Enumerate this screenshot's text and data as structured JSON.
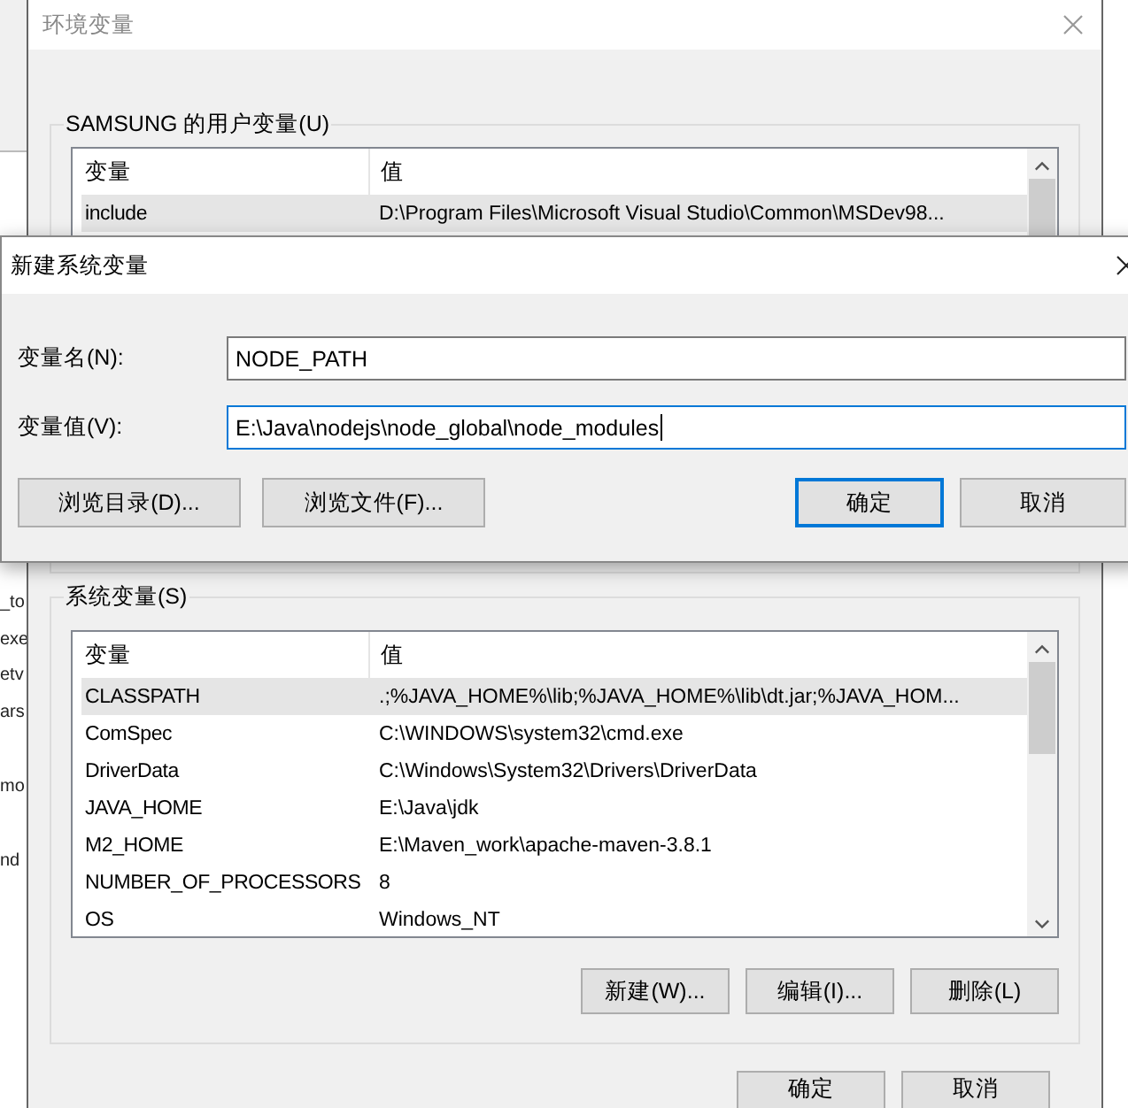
{
  "side_fragments": [
    {
      "lines": [
        "_to",
        "exe",
        "etv",
        "ars"
      ]
    },
    {
      "lines": [
        "mo"
      ]
    },
    {
      "lines": [
        "nd"
      ]
    }
  ],
  "background_window": {
    "title": "环境变量",
    "user_variables": {
      "title": "SAMSUNG 的用户变量(U)",
      "columns": [
        "变量",
        "值"
      ],
      "rows": [
        {
          "name": "include",
          "value": "D:\\Program Files\\Microsoft Visual Studio\\Common\\MSDev98...",
          "selected": true
        }
      ]
    },
    "system_variables": {
      "title": "系统变量(S)",
      "columns": [
        "变量",
        "值"
      ],
      "rows": [
        {
          "name": "CLASSPATH",
          "value": ".;%JAVA_HOME%\\lib;%JAVA_HOME%\\lib\\dt.jar;%JAVA_HOM...",
          "selected": true
        },
        {
          "name": "ComSpec",
          "value": "C:\\WINDOWS\\system32\\cmd.exe",
          "selected": false
        },
        {
          "name": "DriverData",
          "value": "C:\\Windows\\System32\\Drivers\\DriverData",
          "selected": false
        },
        {
          "name": "JAVA_HOME",
          "value": "E:\\Java\\jdk",
          "selected": false
        },
        {
          "name": "M2_HOME",
          "value": "E:\\Maven_work\\apache-maven-3.8.1",
          "selected": false
        },
        {
          "name": "NUMBER_OF_PROCESSORS",
          "value": "8",
          "selected": false
        },
        {
          "name": "OS",
          "value": "Windows_NT",
          "selected": false
        }
      ],
      "buttons": [
        "新建(W)...",
        "编辑(I)...",
        "删除(L)"
      ]
    },
    "footer_buttons": [
      "确定",
      "取消"
    ]
  },
  "dialog": {
    "title": "新建系统变量",
    "fields": [
      {
        "label": "变量名(N):",
        "value": "NODE_PATH",
        "focused": false
      },
      {
        "label": "变量值(V):",
        "value": "E:\\Java\\nodejs\\node_global\\node_modules",
        "focused": true
      }
    ],
    "left_buttons": [
      "浏览目录(D)...",
      "浏览文件(F)..."
    ],
    "right_buttons": [
      {
        "label": "确定",
        "default": true
      },
      {
        "label": "取消",
        "default": false
      }
    ]
  }
}
